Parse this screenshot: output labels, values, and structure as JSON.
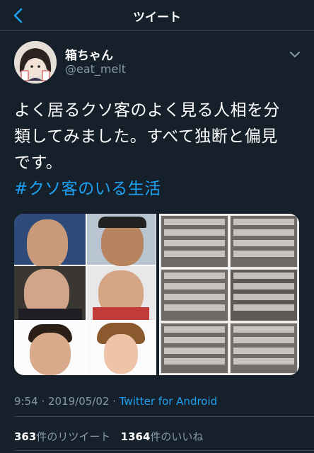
{
  "header": {
    "title": "ツイート",
    "back_icon": "chevron-left-icon"
  },
  "user": {
    "display_name": "箱ちゃん",
    "handle": "@eat_melt"
  },
  "tweet": {
    "line1": "よく居るクソ客のよく見る人相を分",
    "line2": "類してみました。すべて独断と偏見",
    "line3": "です。",
    "hashtag": "#クソ客のいる生活"
  },
  "meta": {
    "time": "9:54 · 2019/05/02 · ",
    "source": "Twitter for Android"
  },
  "stats": {
    "retweets_count": "363",
    "retweets_label": "件のリツイート",
    "likes_count": "1364",
    "likes_label": "件のいいね"
  },
  "colors": {
    "background": "#15202b",
    "accent": "#1da1f2",
    "secondary_text": "#8899a6",
    "divider": "#38444d"
  }
}
